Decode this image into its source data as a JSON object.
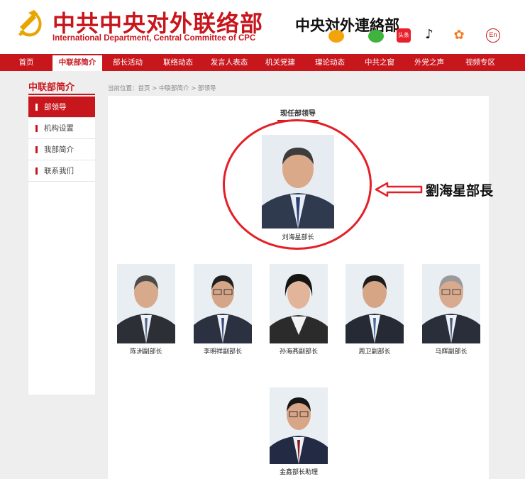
{
  "header": {
    "title_cn": "中共中央对外联络部",
    "title_en": "International Department, Central Committee of CPC",
    "title_traditional": "中央対外連絡部",
    "social_icons": [
      "weibo-icon",
      "wechat-icon",
      "toutiao-icon",
      "tiktok-icon",
      "kuaishou-icon",
      "english-toggle"
    ],
    "toutiao_label": "头条",
    "en_label": "En"
  },
  "nav": {
    "items": [
      "首页",
      "中联部简介",
      "部长活动",
      "联络动态",
      "发言人表态",
      "机关党建",
      "理论动态",
      "中共之窗",
      "外党之声",
      "视频专区"
    ],
    "active_index": 1
  },
  "sidebar": {
    "title": "中联部简介",
    "items": [
      "部领导",
      "机构设置",
      "我部简介",
      "联系我们"
    ],
    "active_index": 0
  },
  "breadcrumb": "当前位置：首页 > 中联部简介 > 部领导",
  "section_title": "现任部领导",
  "head": {
    "caption": "刘海星部长"
  },
  "deputies": [
    {
      "caption": "陈洲副部长"
    },
    {
      "caption": "李明祥副部长"
    },
    {
      "caption": "孙海燕副部长"
    },
    {
      "caption": "周卫副部长"
    },
    {
      "caption": "马辉副部长"
    }
  ],
  "assistant": {
    "caption": "金鑫部长助理"
  },
  "annotation": {
    "label": "劉海星部長"
  },
  "colors": {
    "brand_red": "#c8161d",
    "circle_red": "#e41f26",
    "background": "#eeeeee"
  }
}
